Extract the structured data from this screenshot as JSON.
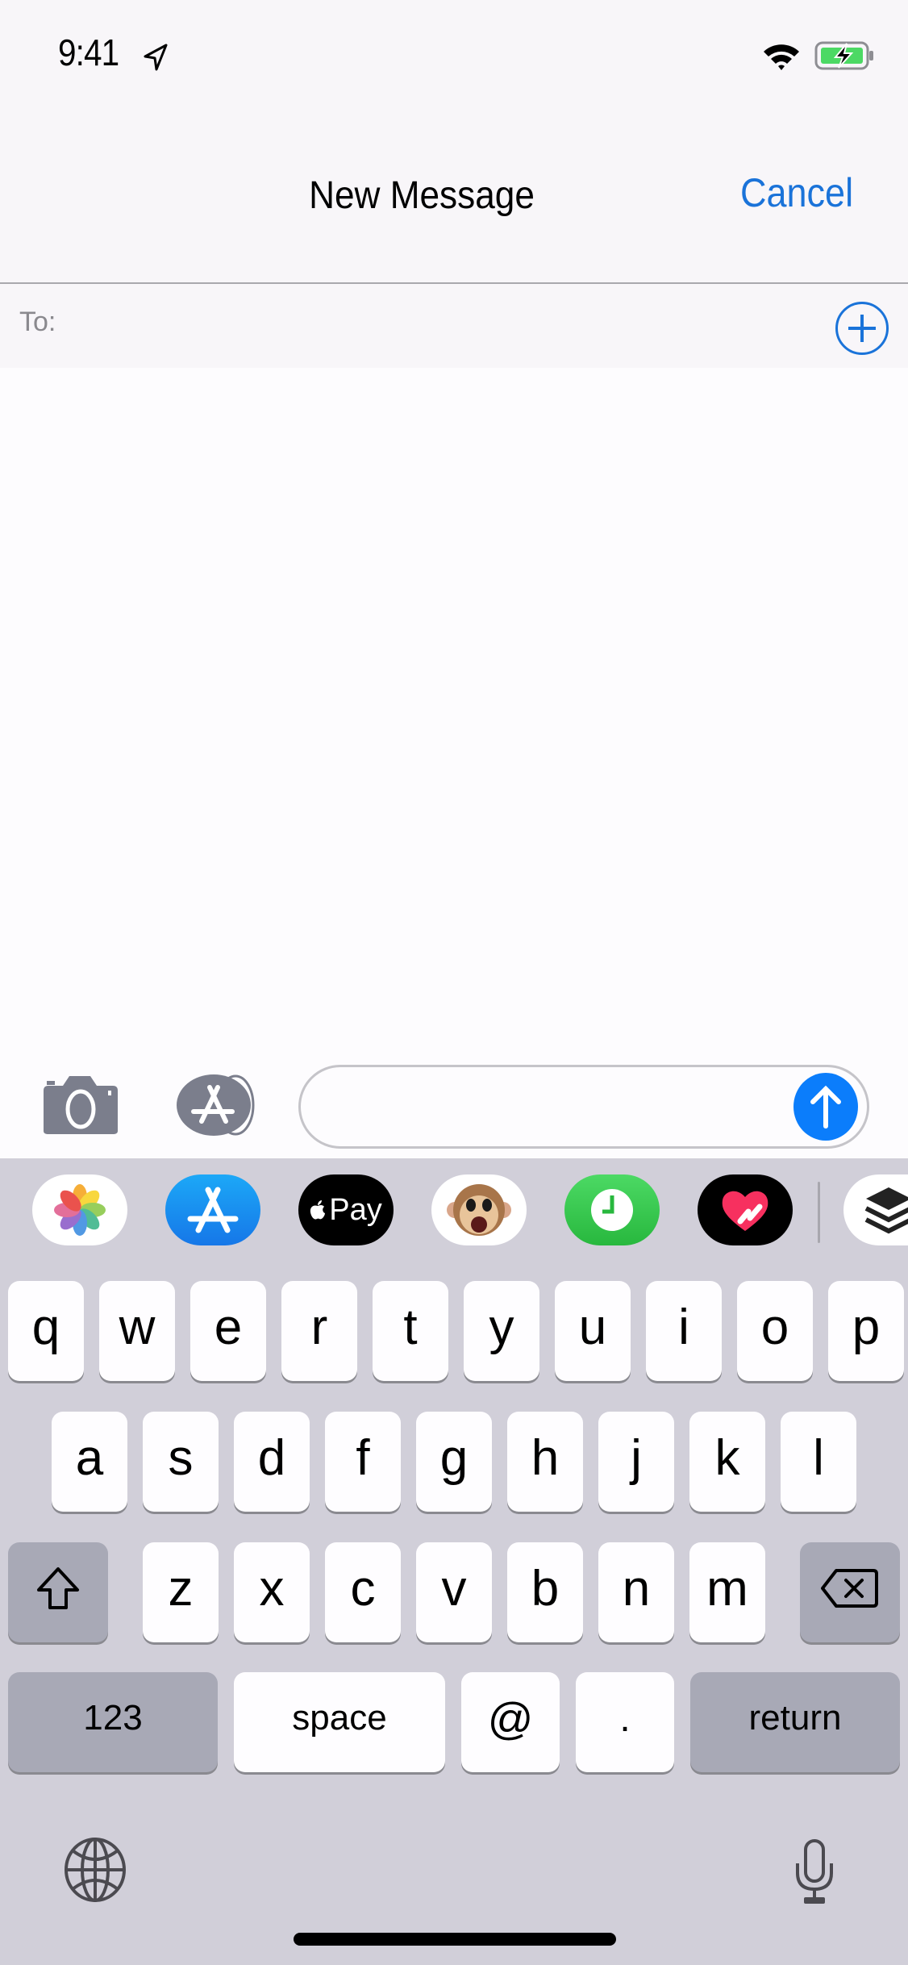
{
  "status_bar": {
    "time": "9:41",
    "location_icon": "location-arrow-icon",
    "wifi_icon": "wifi-icon",
    "battery_icon": "battery-charging-icon",
    "battery_color": "#4cd964"
  },
  "nav": {
    "title": "New Message",
    "cancel_label": "Cancel",
    "accent_color": "#1a73d9"
  },
  "recipient": {
    "label": "To:",
    "value": "",
    "add_icon": "plus-circle-icon"
  },
  "compose": {
    "camera_icon": "camera-icon",
    "apps_icon": "app-store-icon",
    "message_value": "",
    "send_icon": "arrow-up-icon",
    "send_color": "#0b7dfb"
  },
  "app_strip": [
    {
      "name": "Photos",
      "icon": "photos-icon"
    },
    {
      "name": "App Store",
      "icon": "app-store-icon"
    },
    {
      "name": "Apple Pay",
      "icon": "apple-pay-icon",
      "label": "Pay"
    },
    {
      "name": "Animoji",
      "icon": "monkey-animoji-icon"
    },
    {
      "name": "Clock",
      "icon": "clock-icon"
    },
    {
      "name": "Digital Touch",
      "icon": "heart-touch-icon"
    },
    {
      "name": "Stack",
      "icon": "layers-icon"
    }
  ],
  "keyboard": {
    "row1": [
      "q",
      "w",
      "e",
      "r",
      "t",
      "y",
      "u",
      "i",
      "o",
      "p"
    ],
    "row2": [
      "a",
      "s",
      "d",
      "f",
      "g",
      "h",
      "j",
      "k",
      "l"
    ],
    "row3": [
      "z",
      "x",
      "c",
      "v",
      "b",
      "n",
      "m"
    ],
    "shift_icon": "shift-icon",
    "delete_icon": "delete-icon",
    "numbers_label": "123",
    "space_label": "space",
    "at_label": "@",
    "period_label": ".",
    "return_label": "return",
    "globe_icon": "globe-icon",
    "mic_icon": "microphone-icon"
  }
}
